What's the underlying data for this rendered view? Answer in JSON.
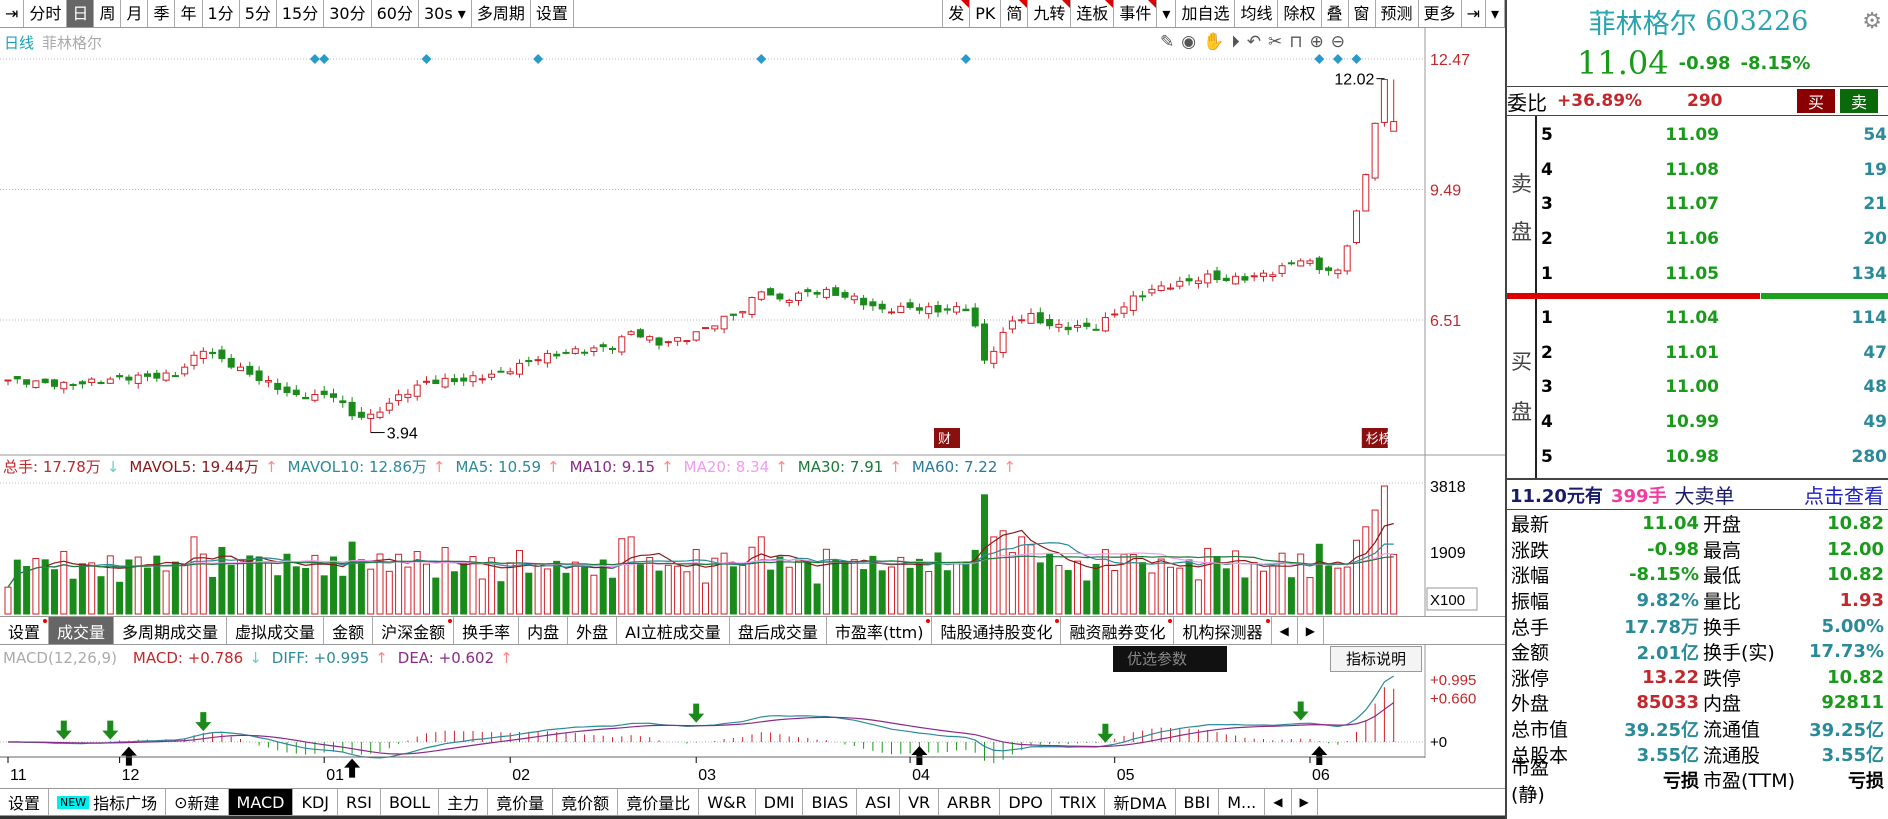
{
  "toolbar": {
    "left": [
      "分时",
      "日",
      "周",
      "月",
      "季",
      "年",
      "1分",
      "5分",
      "15分",
      "30分",
      "60分",
      "30s ▾",
      "多周期",
      "设置"
    ],
    "right": [
      "发",
      "PK",
      "简",
      "九转",
      "连板",
      "事件",
      "▾",
      "加自选",
      "均线",
      "除权",
      "叠",
      "窗",
      "预测",
      "更多",
      "⇥",
      "▾"
    ],
    "active": "日"
  },
  "chart": {
    "period": "日线",
    "name": "菲林格尔",
    "price_axis": [
      "12.47",
      "9.49",
      "6.51"
    ],
    "high_label": "12.02",
    "low_label": "3.94",
    "event_badges": [
      "财",
      "杉榜"
    ]
  },
  "volume": {
    "legend": [
      {
        "t": "总手: 17.78万",
        "c": "#c0282c",
        "arrow": "↓"
      },
      {
        "t": "MAVOL5: 19.44万",
        "c": "#8a1a1a",
        "arrow": "↑"
      },
      {
        "t": "MAVOL10: 12.86万",
        "c": "#2a8a9a",
        "arrow": "↑"
      },
      {
        "t": "MA5: 10.59",
        "c": "#2a8a9a",
        "arrow": "↑"
      },
      {
        "t": "MA10: 9.15",
        "c": "#8a2a8a",
        "arrow": "↑"
      },
      {
        "t": "MA20: 8.34",
        "c": "#f09af0",
        "arrow": "↑"
      },
      {
        "t": "MA30: 7.91",
        "c": "#1a7a3a",
        "arrow": "↑"
      },
      {
        "t": "MA60: 7.22",
        "c": "#2a7a9a",
        "arrow": "↑"
      }
    ],
    "axis": [
      "3818",
      "1909",
      "X100"
    ]
  },
  "ind_tabs": [
    "设置",
    "成交量",
    "多周期成交量",
    "虚拟成交量",
    "金额",
    "沪深金额",
    "换手率",
    "内盘",
    "外盘",
    "AI立桩成交量",
    "盘后成交量",
    "市盈率(ttm)",
    "陆股通持股变化",
    "融资融券变化",
    "机构探测器"
  ],
  "ind_tabs_flag": [
    0,
    5,
    11,
    12,
    13,
    14
  ],
  "macd": {
    "legend": [
      {
        "t": "MACD(12,26,9)",
        "c": "#aaa",
        "arrow": ""
      },
      {
        "t": "MACD: +0.786",
        "c": "#c0282c",
        "arrow": "↓"
      },
      {
        "t": "DIFF: +0.995",
        "c": "#2a8a9a",
        "arrow": "↑"
      },
      {
        "t": "DEA: +0.602",
        "c": "#8a2a8a",
        "arrow": "↑"
      }
    ],
    "btn_params": "优选参数",
    "btn_help": "指标说明",
    "axis": [
      "+0.995",
      "+0.660",
      "+0"
    ]
  },
  "x_months": [
    "11",
    "12",
    "01",
    "02",
    "03",
    "04",
    "05",
    "06"
  ],
  "bottom_tabs": [
    "设置",
    "指标广场",
    "新建",
    "MACD",
    "KDJ",
    "RSI",
    "BOLL",
    "主力",
    "竟价量",
    "竟价额",
    "竟价量比",
    "W&R",
    "DMI",
    "BIAS",
    "ASI",
    "VR",
    "ARBR",
    "DPO",
    "TRIX",
    "新DMA",
    "BBI",
    "M..."
  ],
  "new_badge": "NEW",
  "quote": {
    "name": "菲林格尔",
    "code": "603226",
    "price": "11.04",
    "change": "-0.98",
    "pct": "-8.15%",
    "weibi_label": "委比",
    "weibi": "+36.89%",
    "weicha": "290",
    "buy_btn": "买",
    "sell_btn": "卖",
    "sell_label": [
      "卖",
      "盘"
    ],
    "buy_label": [
      "买",
      "盘"
    ],
    "asks": [
      {
        "lvl": "5",
        "p": "11.09",
        "v": "54"
      },
      {
        "lvl": "4",
        "p": "11.08",
        "v": "19"
      },
      {
        "lvl": "3",
        "p": "11.07",
        "v": "21"
      },
      {
        "lvl": "2",
        "p": "11.06",
        "v": "20"
      },
      {
        "lvl": "1",
        "p": "11.05",
        "v": "134"
      }
    ],
    "bids": [
      {
        "lvl": "1",
        "p": "11.04",
        "v": "114"
      },
      {
        "lvl": "2",
        "p": "11.01",
        "v": "47"
      },
      {
        "lvl": "3",
        "p": "11.00",
        "v": "48"
      },
      {
        "lvl": "4",
        "p": "10.99",
        "v": "49"
      },
      {
        "lvl": "5",
        "p": "10.98",
        "v": "280"
      }
    ],
    "buy_ratio": 0.66,
    "big": {
      "price": "11.20元有",
      "qty": "399手",
      "kind": "大卖单",
      "link": "点击查看"
    },
    "stats": [
      [
        "最新",
        "11.04",
        "g",
        "开盘",
        "10.82",
        "g"
      ],
      [
        "涨跌",
        "-0.98",
        "g",
        "最高",
        "12.00",
        "g"
      ],
      [
        "涨幅",
        "-8.15%",
        "g",
        "最低",
        "10.82",
        "g"
      ],
      [
        "振幅",
        "9.82%",
        "t",
        "量比",
        "1.93",
        "r"
      ],
      [
        "总手",
        "17.78万",
        "t",
        "换手",
        "5.00%",
        "t"
      ],
      [
        "金额",
        "2.01亿",
        "t",
        "换手(实)",
        "17.73%",
        "t"
      ],
      [
        "涨停",
        "13.22",
        "r",
        "跌停",
        "10.82",
        "g"
      ],
      [
        "外盘",
        "85033",
        "r",
        "内盘",
        "92811",
        "g"
      ],
      [
        "总市值",
        "39.25亿",
        "t",
        "流通值",
        "39.25亿",
        "t"
      ],
      [
        "总股本",
        "3.55亿",
        "t",
        "流通股",
        "3.55亿",
        "t"
      ],
      [
        "市盈(静)",
        "亏损",
        "k",
        "市盈(TTM)",
        "亏损",
        "k"
      ]
    ]
  },
  "chart_data": {
    "type": "candlestick",
    "ylim": [
      3.5,
      12.9
    ],
    "close_keypoints": [
      [
        0,
        5.14
      ],
      [
        6,
        5.03
      ],
      [
        13,
        5.2
      ],
      [
        18,
        5.25
      ],
      [
        21,
        5.85
      ],
      [
        23,
        5.6
      ],
      [
        27,
        5.17
      ],
      [
        31,
        4.76
      ],
      [
        35,
        4.8
      ],
      [
        37,
        4.34
      ],
      [
        39,
        4.3
      ],
      [
        42,
        4.76
      ],
      [
        45,
        5.1
      ],
      [
        49,
        5.14
      ],
      [
        53,
        5.3
      ],
      [
        57,
        5.65
      ],
      [
        61,
        5.8
      ],
      [
        65,
        5.9
      ],
      [
        67,
        6.25
      ],
      [
        70,
        5.98
      ],
      [
        73,
        6.1
      ],
      [
        77,
        6.54
      ],
      [
        79,
        6.73
      ],
      [
        81,
        7.2
      ],
      [
        83,
        6.95
      ],
      [
        86,
        7.15
      ],
      [
        88,
        7.15
      ],
      [
        91,
        7.0
      ],
      [
        94,
        6.73
      ],
      [
        97,
        6.8
      ],
      [
        100,
        6.73
      ],
      [
        103,
        6.78
      ],
      [
        104,
        6.35
      ],
      [
        105,
        5.57
      ],
      [
        106,
        5.85
      ],
      [
        108,
        6.5
      ],
      [
        110,
        6.6
      ],
      [
        112,
        6.38
      ],
      [
        114,
        6.35
      ],
      [
        117,
        6.35
      ],
      [
        119,
        6.67
      ],
      [
        121,
        7.0
      ],
      [
        123,
        7.2
      ],
      [
        126,
        7.35
      ],
      [
        129,
        7.5
      ],
      [
        131,
        7.43
      ],
      [
        134,
        7.5
      ],
      [
        136,
        7.6
      ],
      [
        139,
        7.9
      ],
      [
        141,
        7.7
      ],
      [
        143,
        7.6
      ],
      [
        144,
        8.2
      ],
      [
        145,
        9.0
      ],
      [
        146,
        9.83
      ],
      [
        147,
        11.0
      ],
      [
        148,
        12.0
      ],
      [
        149,
        11.04
      ]
    ],
    "high": 12.02,
    "low": 3.94,
    "volume_max": 3818
  }
}
